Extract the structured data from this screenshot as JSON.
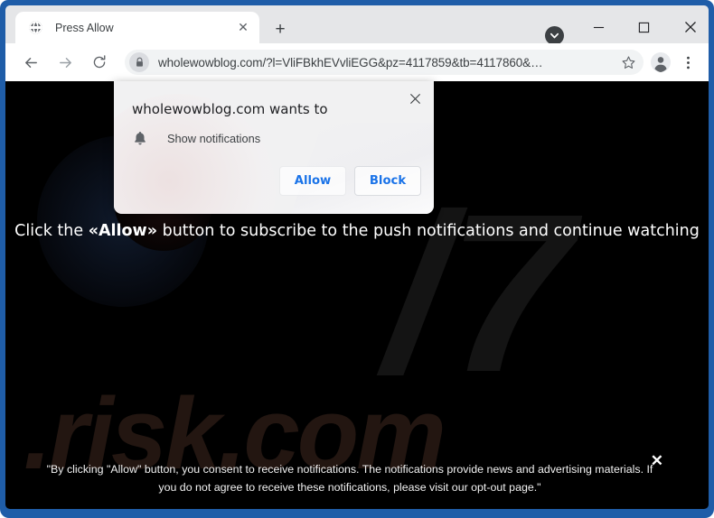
{
  "browser": {
    "tab": {
      "title": "Press Allow",
      "favicon_icon": "globe-icon",
      "close_icon": "✕"
    },
    "new_tab_icon": "+",
    "tab_search_icon": "▾",
    "window_controls": {
      "minimize": "–",
      "maximize": "□",
      "close": "✕"
    },
    "toolbar": {
      "back_icon": "←",
      "forward_icon": "→",
      "reload_icon": "↻",
      "lock_icon": "lock-icon",
      "url": "wholewowblog.com/?l=VliFBkhEVvliEGG&pz=4117859&tb=4117860&…",
      "bookmark_icon": "☆",
      "profile_icon": "avatar-icon",
      "menu_icon": "⋮"
    }
  },
  "permission_dialog": {
    "title": "wholewowblog.com wants to",
    "permission_icon": "bell-icon",
    "permission_label": "Show notifications",
    "allow_label": "Allow",
    "block_label": "Block",
    "close_icon": "✕"
  },
  "page": {
    "cta_prefix": "Click the ",
    "cta_emphasis": "«Allow»",
    "cta_suffix": " button to subscribe to the push notifications and continue watching",
    "watermark_wordmark": ".risk.com",
    "watermark_glyph": "/7",
    "consent_text": "\"By clicking \"Allow\" button, you consent to receive notifications. The notifications provide news and advertising materials. If you do not agree to receive these notifications, please visit our opt-out page.\"",
    "consent_close_icon": "✕",
    "background_color": "#000000"
  },
  "colors": {
    "window_frame": "#1f5da8",
    "tabstrip": "#e5e6e8",
    "accent_link": "#1a73e8",
    "page_background": "#000000",
    "page_text": "#ffffff"
  }
}
